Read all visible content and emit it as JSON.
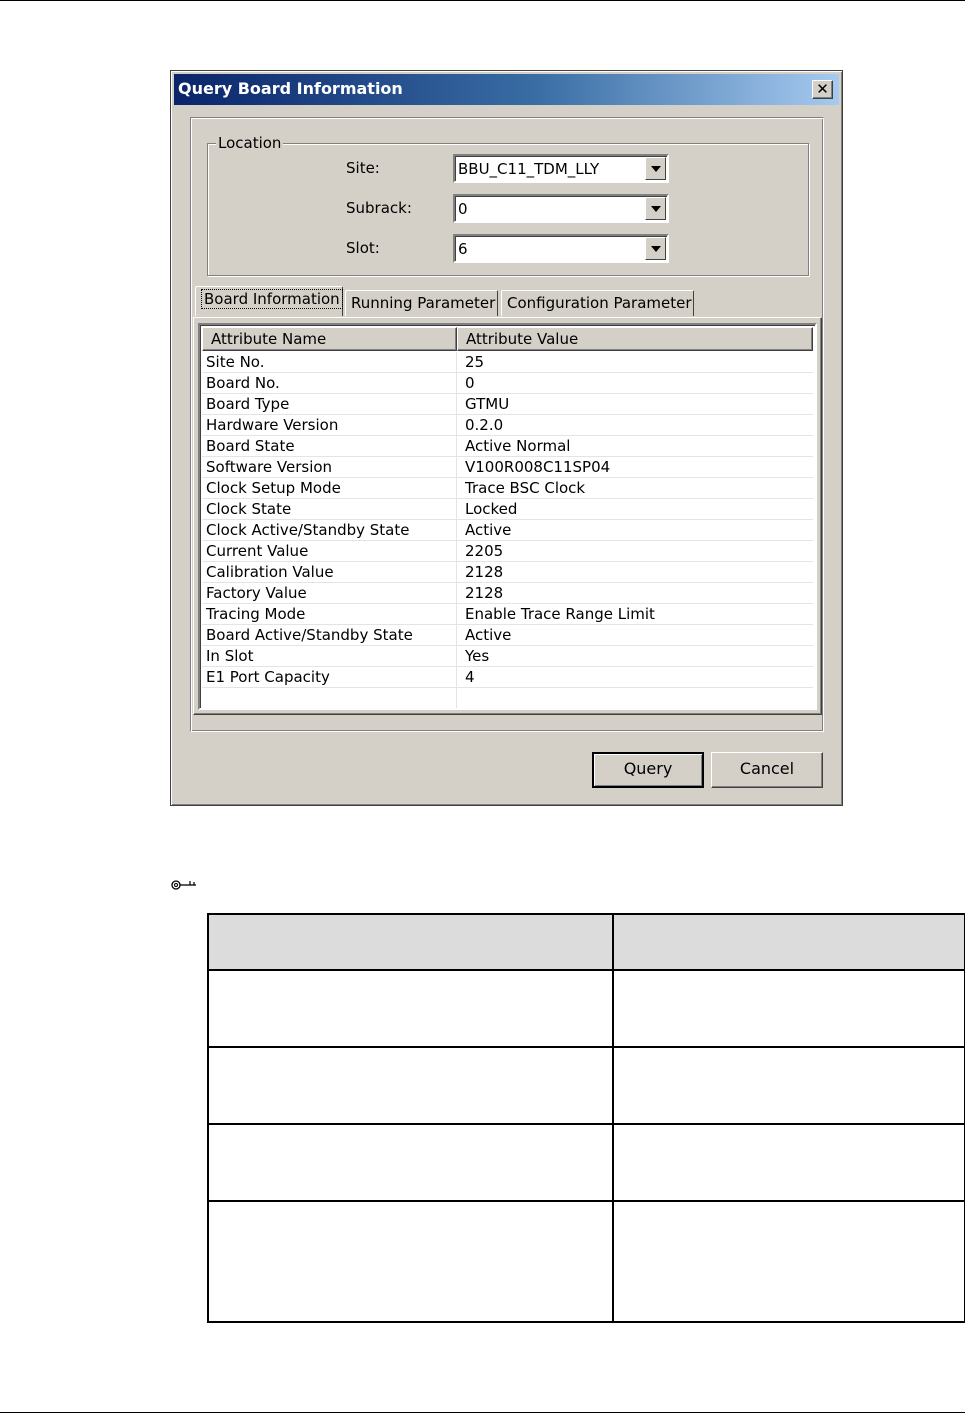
{
  "dialog": {
    "title": "Query Board Information",
    "close_glyph": "✕",
    "location": {
      "legend": "Location",
      "site_label": "Site:",
      "site_value": "BBU_C11_TDM_LLY",
      "subrack_label": "Subrack:",
      "subrack_value": "0",
      "slot_label": "Slot:",
      "slot_value": "6"
    },
    "tabs": [
      {
        "label": "Board Information",
        "active": true
      },
      {
        "label": "Running Parameter",
        "active": false
      },
      {
        "label": "Configuration Parameter",
        "active": false
      }
    ],
    "table": {
      "columns": [
        "Attribute Name",
        "Attribute Value"
      ],
      "rows": [
        {
          "name": "Site No.",
          "value": "25"
        },
        {
          "name": "Board No.",
          "value": "0"
        },
        {
          "name": "Board Type",
          "value": "GTMU"
        },
        {
          "name": "Hardware Version",
          "value": "0.2.0"
        },
        {
          "name": "Board State",
          "value": "Active Normal"
        },
        {
          "name": "Software Version",
          "value": "V100R008C11SP04"
        },
        {
          "name": "Clock Setup Mode",
          "value": "Trace BSC Clock"
        },
        {
          "name": "Clock State",
          "value": "Locked"
        },
        {
          "name": "Clock Active/Standby State",
          "value": "Active"
        },
        {
          "name": "Current Value",
          "value": "2205"
        },
        {
          "name": "Calibration Value",
          "value": "2128"
        },
        {
          "name": "Factory Value",
          "value": "2128"
        },
        {
          "name": "Tracing Mode",
          "value": "Enable Trace Range Limit"
        },
        {
          "name": "Board Active/Standby State",
          "value": "Active"
        },
        {
          "name": "In Slot",
          "value": "Yes"
        },
        {
          "name": "E1 Port Capacity",
          "value": "4"
        },
        {
          "name": "",
          "value": ""
        }
      ]
    },
    "buttons": {
      "query": "Query",
      "cancel": "Cancel"
    }
  },
  "icons": {
    "close": "close-icon",
    "dropdown": "chevron-down-icon",
    "note": "key-icon"
  },
  "colors": {
    "title_gradient_start": "#0a246a",
    "title_gradient_end": "#a6caf0",
    "face": "#d4d0c8"
  }
}
